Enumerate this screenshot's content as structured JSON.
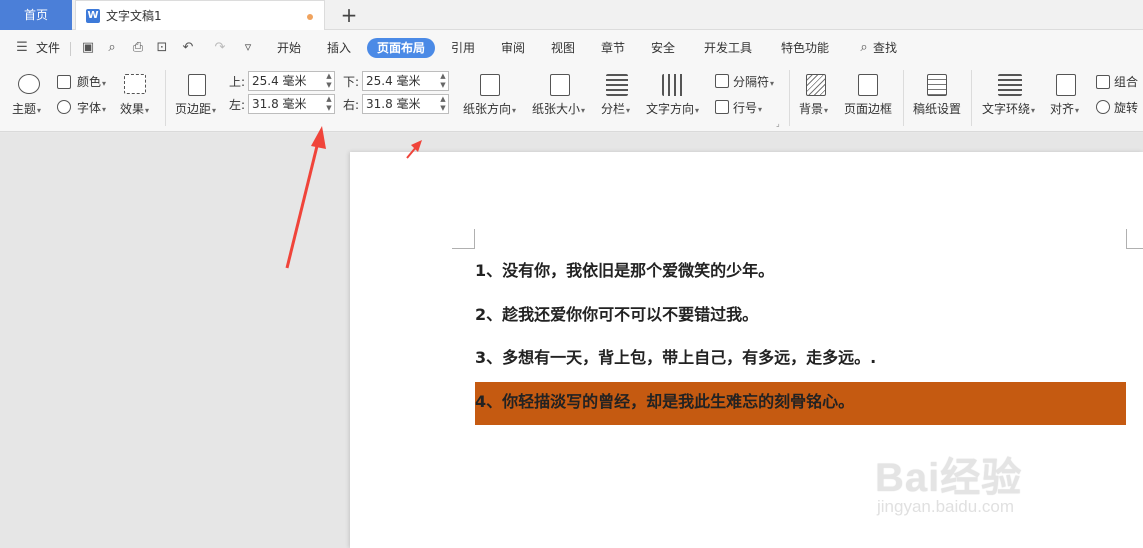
{
  "tabs": {
    "home": "首页",
    "doc_icon": "W",
    "doc_title": "文字文稿1",
    "add": "+"
  },
  "menu": {
    "file": "文件",
    "items": [
      "开始",
      "插入",
      "页面布局",
      "引用",
      "审阅",
      "视图",
      "章节",
      "安全",
      "开发工具",
      "特色功能"
    ],
    "active": "页面布局",
    "search": "查找"
  },
  "ribbon": {
    "theme": "主题",
    "color": "颜色",
    "font": "字体",
    "effect": "效果",
    "margins": "页边距",
    "top_label": "上:",
    "top_value": "25.4 毫米",
    "bottom_label": "下:",
    "bottom_value": "25.4 毫米",
    "left_label": "左:",
    "left_value": "31.8 毫米",
    "right_label": "右:",
    "right_value": "31.8 毫米",
    "orientation": "纸张方向",
    "size": "纸张大小",
    "columns": "分栏",
    "text_direction": "文字方向",
    "separator": "分隔符",
    "line_number": "行号",
    "background": "背景",
    "page_border": "页面边框",
    "paper_setup": "稿纸设置",
    "text_wrap": "文字环绕",
    "align": "对齐",
    "group": "组合",
    "rotate": "旋转"
  },
  "document": {
    "paragraphs": [
      "1、没有你，我依旧是那个爱微笑的少年。",
      "2、趁我还爱你你可不可以不要错过我。",
      "3、多想有一天，背上包，带上自己，有多远，走多远。.",
      "4、你轻描淡写的曾经，却是我此生难忘的刻骨铭心。"
    ],
    "highlight_color": "#c55a11"
  },
  "watermark": {
    "brand": "Bai经验",
    "url": "jingyan.baidu.com"
  },
  "colors": {
    "accent": "#4b8ae6",
    "home_tab": "#4b7fd8",
    "annotation_arrow": "#f0443a"
  }
}
